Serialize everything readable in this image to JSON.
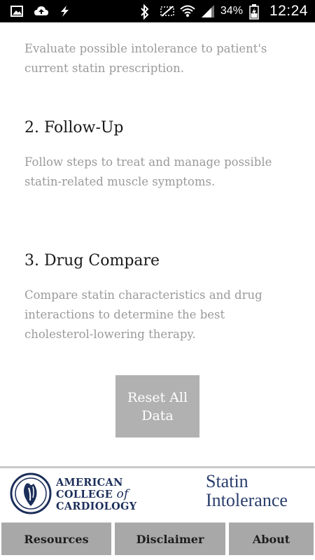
{
  "status_bar": {
    "battery_percent": "34%",
    "time": "12:24",
    "icons": [
      "image-icon",
      "cloud-upload-icon",
      "lightning-icon",
      "bluetooth-icon",
      "mute-icon",
      "wifi-icon",
      "signal-icon",
      "battery-icon"
    ]
  },
  "sections": [
    {
      "description": "Evaluate possible intolerance to patient's current statin prescription."
    },
    {
      "title": "2. Follow-Up",
      "description": "Follow steps to treat and manage possible statin-related muscle symptoms."
    },
    {
      "title": "3. Drug Compare",
      "description": "Compare statin characteristics and drug interactions to determine the best cholesterol-lowering therapy."
    }
  ],
  "reset_button": {
    "label": "Reset All Data"
  },
  "footer": {
    "acc_logo": {
      "line1": "AMERICAN",
      "line2_a": "COLLEGE",
      "line2_b": "of",
      "line3": "CARDIOLOGY"
    },
    "app_logo": {
      "line1": "Statin",
      "line2": "Intolerance"
    },
    "colors": {
      "logo_navy": "#1c2f5a",
      "nav_gray": "#a8a8a8",
      "button_gray": "#b1b1b1"
    }
  },
  "nav": {
    "resources": "Resources",
    "disclaimer": "Disclaimer",
    "about": "About"
  }
}
